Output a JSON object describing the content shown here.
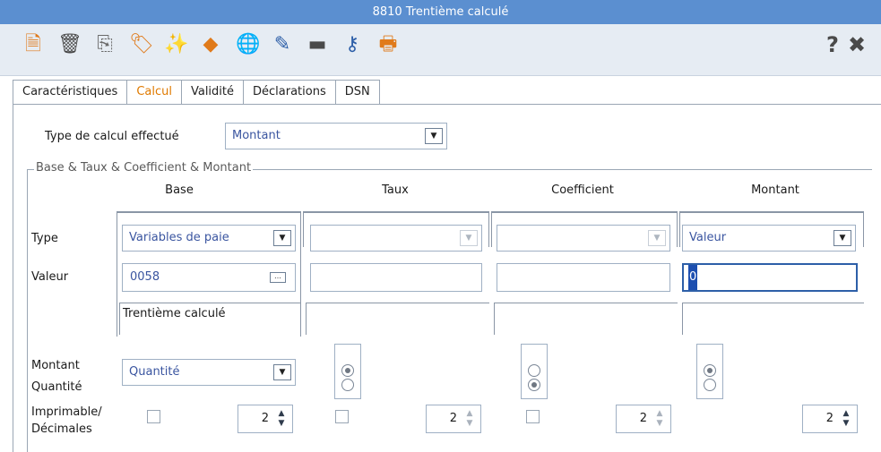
{
  "window": {
    "title": "8810 Trentième calculé"
  },
  "toolbar": {
    "icons": [
      {
        "name": "new-document-icon",
        "glyph": "🗎",
        "color": "#e07a1a"
      },
      {
        "name": "trash-icon",
        "glyph": "🗑",
        "color": "#4a4a4a"
      },
      {
        "name": "copy-icon",
        "glyph": "⎘",
        "color": "#6a6a6a"
      },
      {
        "name": "tag-link-icon",
        "glyph": "🏷",
        "color": "#e07a1a"
      },
      {
        "name": "magic-wand-icon",
        "glyph": "✨",
        "color": "#3a8a3a"
      },
      {
        "name": "calculator-icon",
        "glyph": "◆",
        "color": "#e07a1a"
      },
      {
        "name": "globe-icon",
        "glyph": "🌐",
        "color": "#5a5a5a"
      },
      {
        "name": "pin-icon",
        "glyph": "✎",
        "color": "#2d5fa8"
      },
      {
        "name": "folder-icon",
        "glyph": "▬",
        "color": "#4a4a4a"
      },
      {
        "name": "key-icon",
        "glyph": "⚷",
        "color": "#2d5fa8"
      },
      {
        "name": "printer-icon",
        "glyph": "🖶",
        "color": "#e07a1a"
      }
    ],
    "help_glyph": "?",
    "close_glyph": "✖"
  },
  "tabs": [
    "Caractéristiques",
    "Calcul",
    "Validité",
    "Déclarations",
    "DSN"
  ],
  "active_tab": "Calcul",
  "calc_type": {
    "label": "Type de calcul effectué",
    "value": "Montant"
  },
  "group": {
    "legend": "Base & Taux & Coefficient & Montant",
    "columns": [
      "Base",
      "Taux",
      "Coefficient",
      "Montant"
    ],
    "row_labels": {
      "type": "Type",
      "valeur": "Valeur",
      "montant": "Montant",
      "quantite": "Quantité",
      "imprimable": "Imprimable/",
      "decimales": "Décimales"
    },
    "base": {
      "type": "Variables de paie",
      "valeur": "0058",
      "valeur_button": "…",
      "description": "Trentième calculé",
      "montant_quantite": "Quantité",
      "decimales": "2"
    },
    "taux": {
      "type": "",
      "valeur": "",
      "radio_selected": "top",
      "decimales": "2"
    },
    "coefficient": {
      "type": "",
      "valeur": "",
      "radio_selected": "bottom",
      "decimales": "2"
    },
    "montant": {
      "type": "Valeur",
      "valeur": "0",
      "radio_selected": "top",
      "decimales": "2"
    }
  }
}
